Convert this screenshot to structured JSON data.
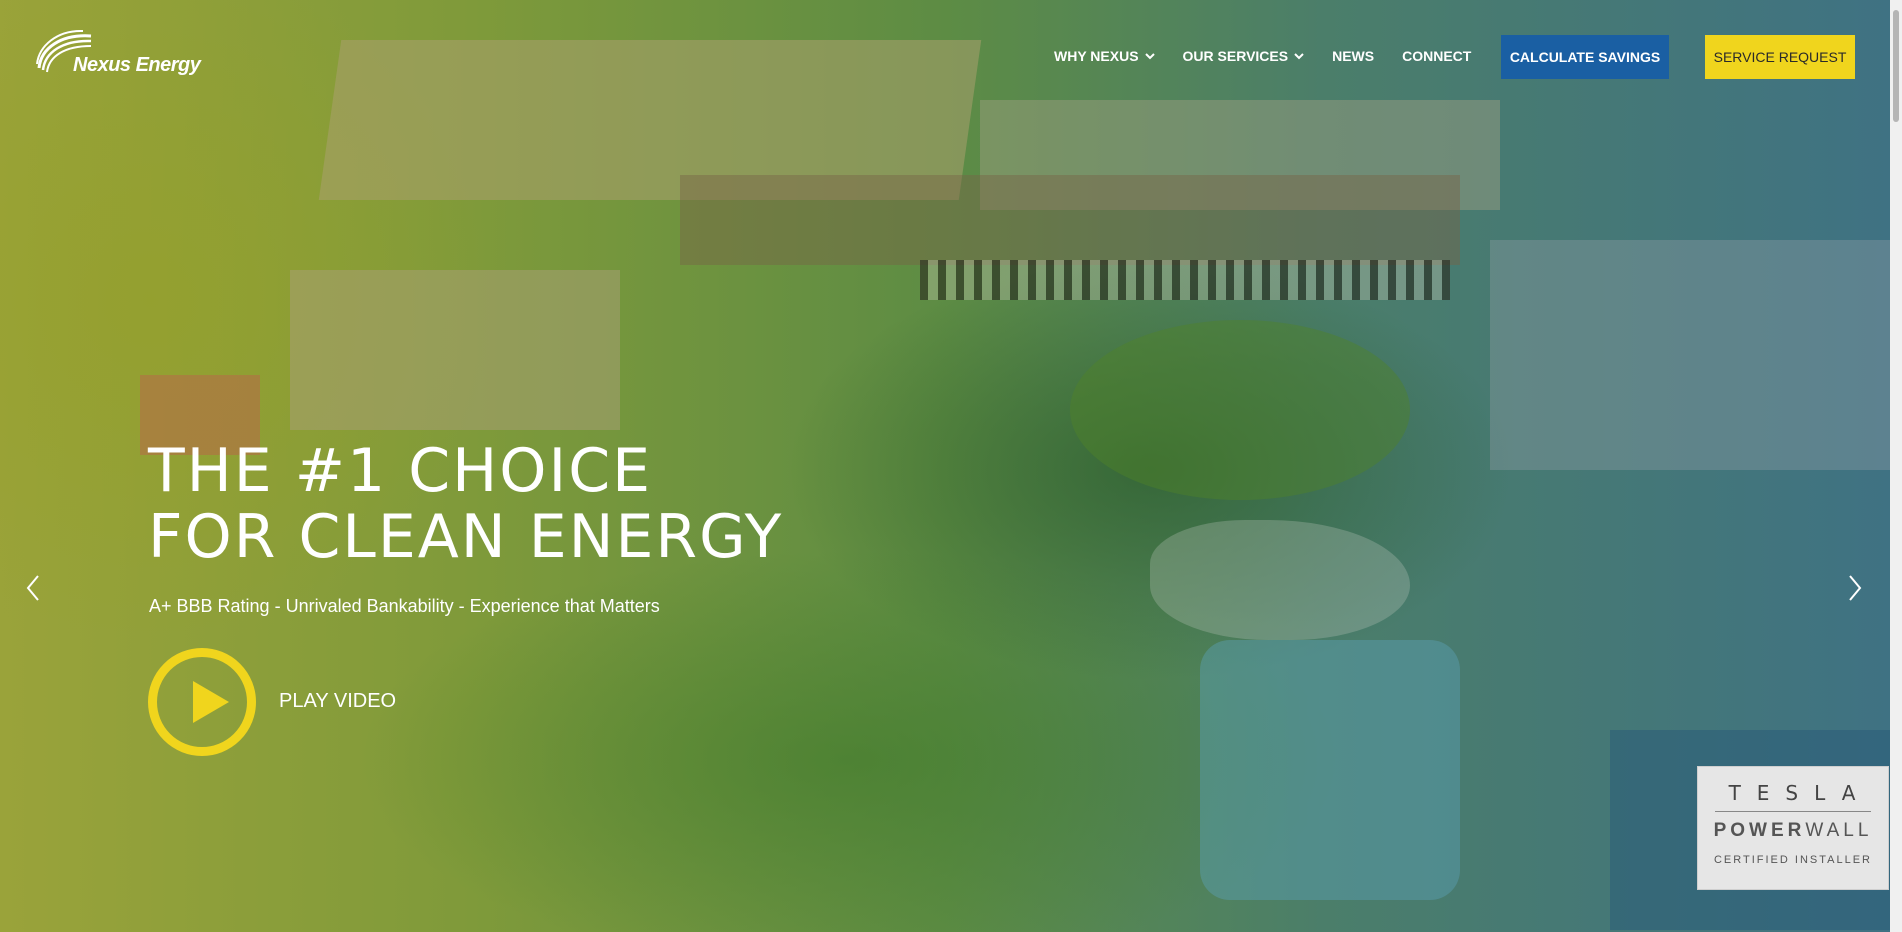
{
  "brand": {
    "name": "Nexus Energy"
  },
  "nav": {
    "items": [
      {
        "label": "WHY NEXUS",
        "dropdown": true
      },
      {
        "label": "OUR SERVICES",
        "dropdown": true
      },
      {
        "label": "NEWS",
        "dropdown": false
      },
      {
        "label": "CONNECT",
        "dropdown": false
      }
    ],
    "cta_primary": "CALCULATE SAVINGS",
    "cta_secondary": "SERVICE REQUEST"
  },
  "hero": {
    "headline_line1": "THE #1 CHOICE",
    "headline_line2": "FOR CLEAN ENERGY",
    "tagline": "A+ BBB Rating - Unrivaled Bankability - Experience that Matters",
    "play_label": "PLAY VIDEO"
  },
  "badge": {
    "brand": "TESLA",
    "product_bold": "POWER",
    "product_light": "WALL",
    "certification": "CERTIFIED INSTALLER"
  },
  "icons": {
    "prev": "chevron-left-icon",
    "next": "chevron-right-icon",
    "play": "play-icon",
    "dropdown": "chevron-down-icon"
  },
  "colors": {
    "primary_blue": "#1a5fa3",
    "accent_yellow": "#f0d51d",
    "text_light": "#ffffff"
  }
}
